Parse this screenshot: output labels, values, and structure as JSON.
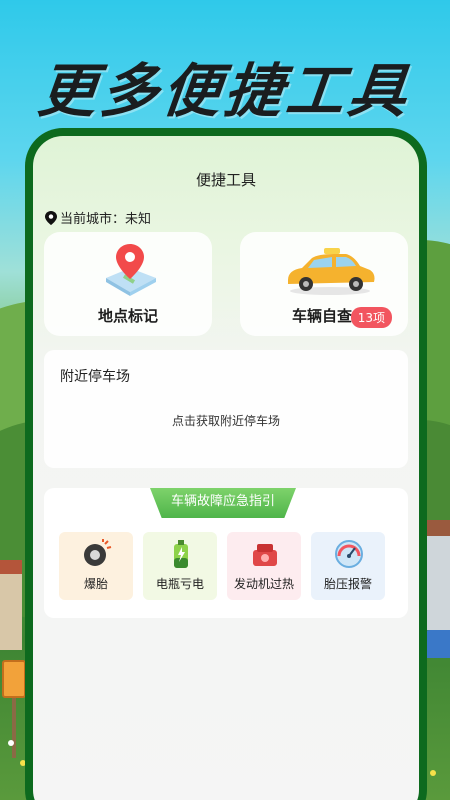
{
  "headline": "更多便捷工具",
  "page_title": "便捷工具",
  "location": {
    "prefix": "当前城市：",
    "city": "未知"
  },
  "tools": [
    {
      "label": "地点标记",
      "icon": "map-pin-icon"
    },
    {
      "label": "车辆自查",
      "icon": "taxi-car-icon",
      "badge": "13项"
    }
  ],
  "parking": {
    "title": "附近停车场",
    "action": "点击获取附近停车场"
  },
  "guide": {
    "title": "车辆故障应急指引",
    "items": [
      {
        "label": "爆胎",
        "icon": "tire-icon"
      },
      {
        "label": "电瓶亏电",
        "icon": "battery-icon"
      },
      {
        "label": "发动机过热",
        "icon": "engine-icon"
      },
      {
        "label": "胎压报警",
        "icon": "pressure-gauge-icon"
      }
    ]
  },
  "colors": {
    "phone_frame": "#0d6a1e",
    "badge": "#f2555f",
    "guide_tab": "#4fb54a"
  }
}
